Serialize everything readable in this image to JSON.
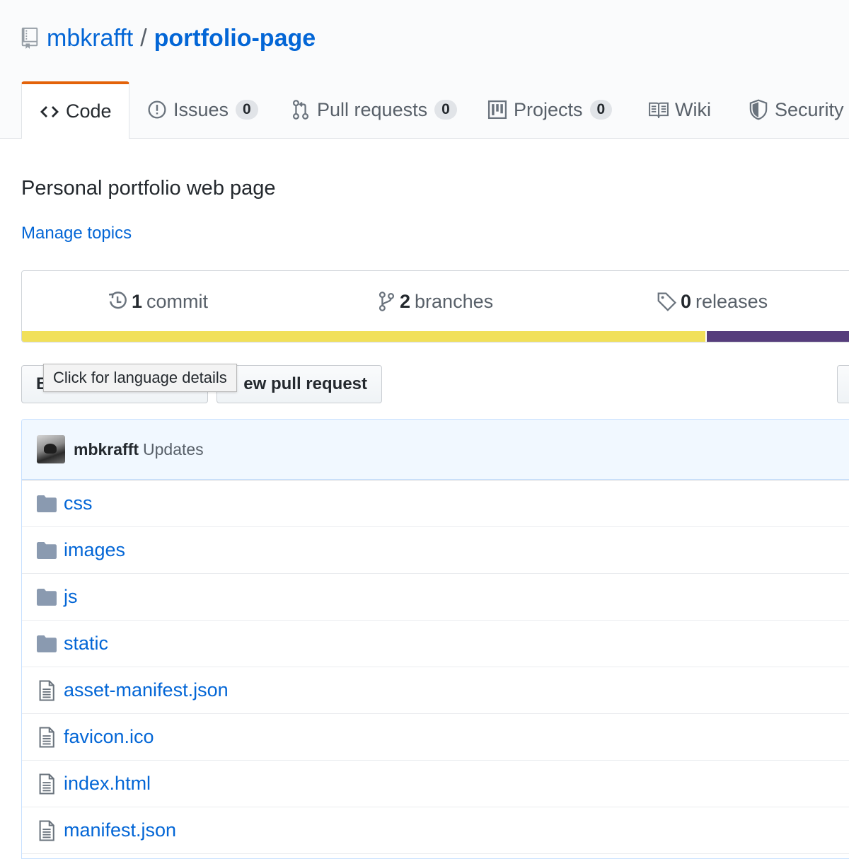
{
  "repo": {
    "owner": "mbkrafft",
    "separator": "/",
    "name": "portfolio-page"
  },
  "tabs": [
    {
      "label": "Code",
      "icon": "code-icon",
      "selected": true
    },
    {
      "label": "Issues",
      "icon": "issue-icon",
      "count": "0"
    },
    {
      "label": "Pull requests",
      "icon": "pull-request-icon",
      "count": "0"
    },
    {
      "label": "Projects",
      "icon": "project-icon",
      "count": "0"
    },
    {
      "label": "Wiki",
      "icon": "book-icon"
    },
    {
      "label": "Security",
      "icon": "shield-icon"
    }
  ],
  "description": "Personal portfolio web page",
  "manage_topics": "Manage topics",
  "summary": {
    "commits": {
      "count": "1",
      "label": "commit"
    },
    "branches": {
      "count": "2",
      "label": "branches"
    },
    "releases": {
      "count": "0",
      "label": "releases"
    }
  },
  "language_bar": [
    {
      "color": "#f1e05a",
      "fraction": 0.82
    },
    {
      "color": "#563d7c",
      "fraction": 0.18
    }
  ],
  "buttons": {
    "left_partial": "B",
    "new_pull_request_partial": "ew pull request"
  },
  "tooltip": "Click for language details",
  "latest_commit": {
    "author": "mbkrafft",
    "message": "Updates"
  },
  "files": [
    {
      "name": "css",
      "type": "directory"
    },
    {
      "name": "images",
      "type": "directory"
    },
    {
      "name": "js",
      "type": "directory"
    },
    {
      "name": "static",
      "type": "directory"
    },
    {
      "name": "asset-manifest.json",
      "type": "file"
    },
    {
      "name": "favicon.ico",
      "type": "file"
    },
    {
      "name": "index.html",
      "type": "file"
    },
    {
      "name": "manifest.json",
      "type": "file"
    }
  ],
  "colors": {
    "link": "#0366d6",
    "selected_tab_accent": "#e36209",
    "folder_icon": "#79b8ff"
  }
}
